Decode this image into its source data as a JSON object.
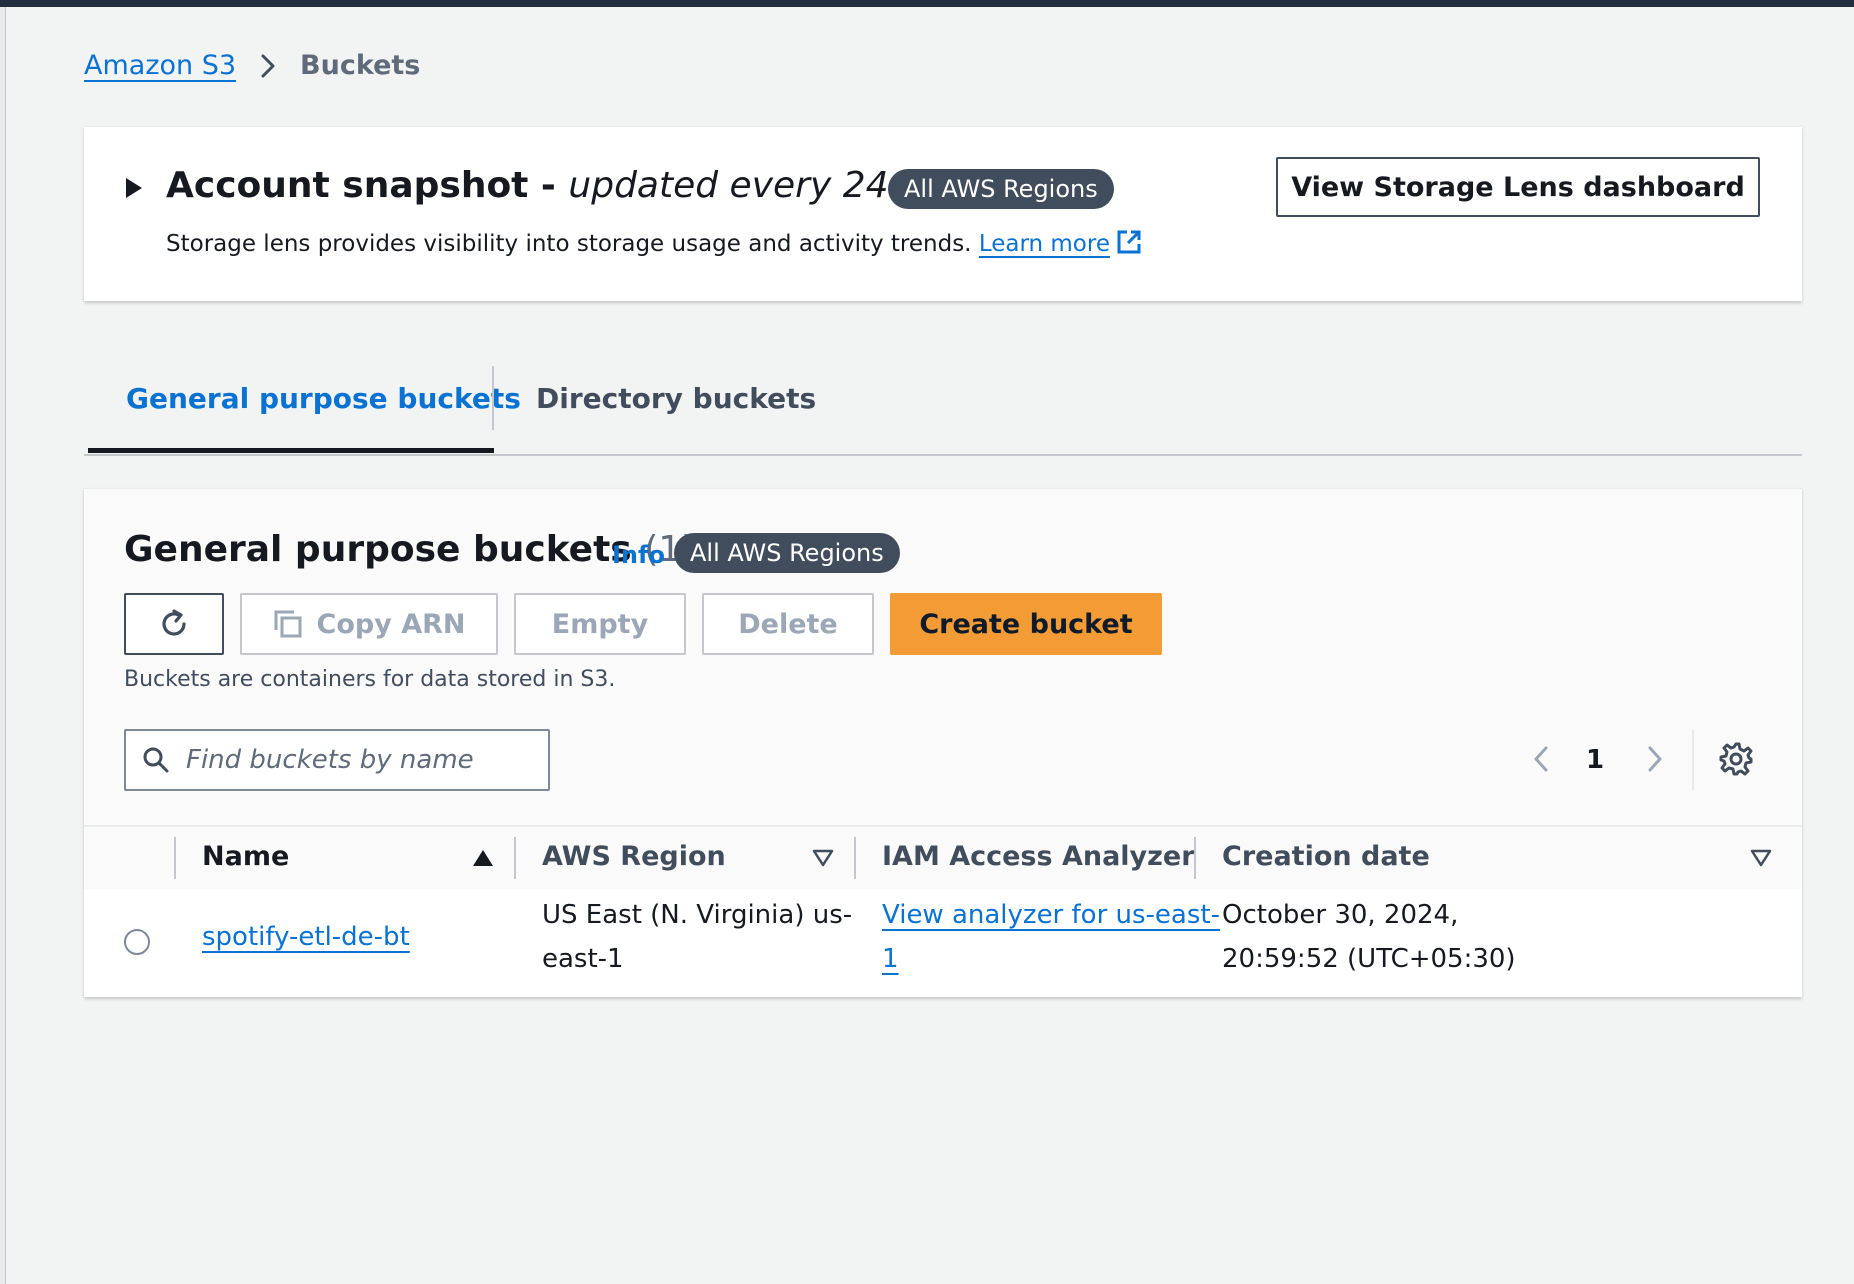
{
  "breadcrumb": {
    "root": "Amazon S3",
    "current": "Buckets"
  },
  "snapshot": {
    "title_bold": "Account snapshot - ",
    "title_italic": "updated every 24 hours",
    "region_badge": "All AWS Regions",
    "description": "Storage lens provides visibility into storage usage and activity trends.",
    "learn_more": "Learn more",
    "dashboard_button": "View Storage Lens dashboard"
  },
  "tabs": [
    {
      "label": "General purpose buckets",
      "active": true
    },
    {
      "label": "Directory buckets",
      "active": false
    }
  ],
  "buckets_panel": {
    "title": "General purpose buckets",
    "count": "(1)",
    "info_link": "Info",
    "region_badge": "All AWS Regions",
    "actions": {
      "copy_arn": "Copy ARN",
      "empty": "Empty",
      "delete": "Delete",
      "create": "Create bucket"
    },
    "description": "Buckets are containers for data stored in S3.",
    "search_placeholder": "Find buckets by name",
    "page_number": "1"
  },
  "table": {
    "columns": [
      "Name",
      "AWS Region",
      "IAM Access Analyzer",
      "Creation date"
    ],
    "rows": [
      {
        "name": "spotify-etl-de-bt",
        "region_line1": "US East (N. Virginia) us-",
        "region_line2": "east-1",
        "analyzer_line1": "View analyzer for us-east-",
        "analyzer_line2": "1",
        "date_line1": "October 30, 2024,",
        "date_line2": "20:59:52 (UTC+05:30)"
      }
    ]
  },
  "colors": {
    "link": "#0972d3",
    "primary_button": "#f39c35",
    "badge": "#414d5c",
    "background": "#f2f3f3"
  },
  "icons": [
    "chevron-right-icon",
    "caret-right-icon",
    "external-link-icon",
    "refresh-icon",
    "copy-icon",
    "search-icon",
    "chevron-left-icon",
    "settings-gear-icon",
    "sort-ascending-icon",
    "sort-descending-icon"
  ]
}
